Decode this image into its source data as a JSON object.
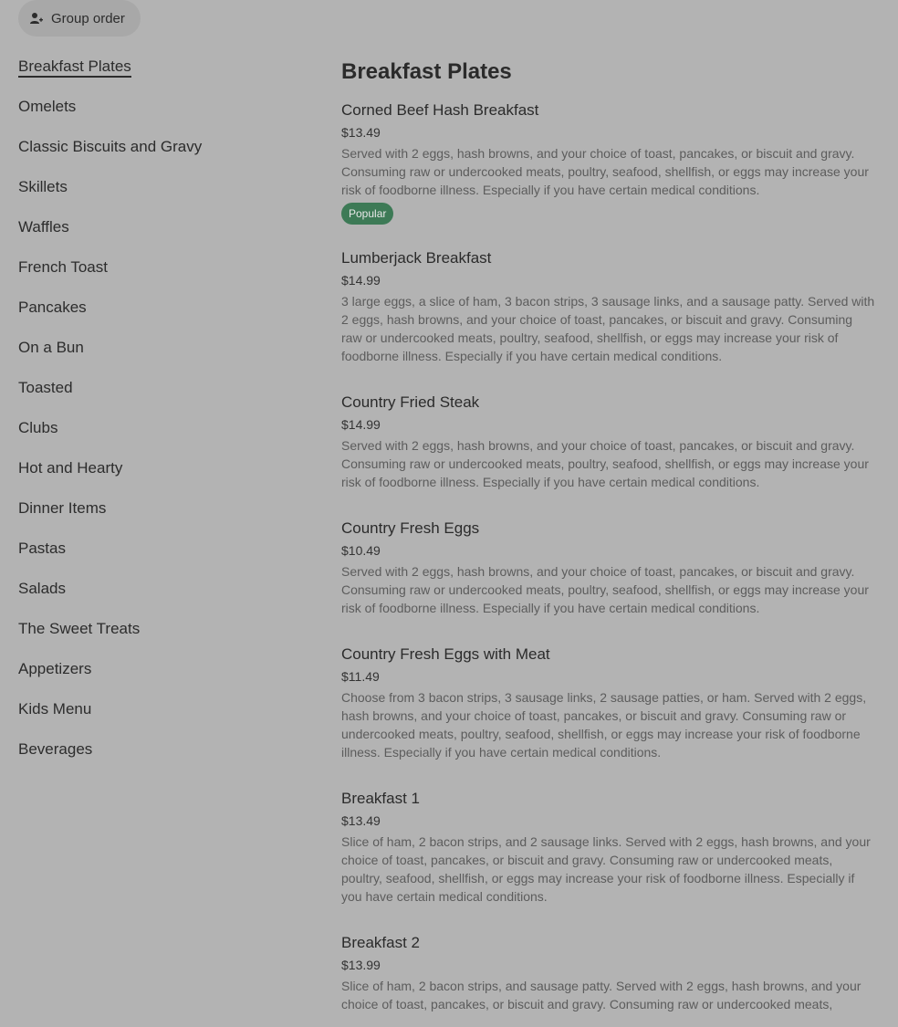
{
  "header": {
    "group_order_label": "Group order",
    "group_order_icon": "person-add-icon"
  },
  "sidebar": {
    "items": [
      {
        "label": "Breakfast Plates",
        "active": true
      },
      {
        "label": "Omelets"
      },
      {
        "label": "Classic Biscuits and Gravy"
      },
      {
        "label": "Skillets"
      },
      {
        "label": "Waffles"
      },
      {
        "label": "French Toast"
      },
      {
        "label": "Pancakes"
      },
      {
        "label": "On a Bun"
      },
      {
        "label": "Toasted"
      },
      {
        "label": "Clubs"
      },
      {
        "label": "Hot and Hearty"
      },
      {
        "label": "Dinner Items"
      },
      {
        "label": "Pastas"
      },
      {
        "label": "Salads"
      },
      {
        "label": "The Sweet Treats"
      },
      {
        "label": "Appetizers"
      },
      {
        "label": "Kids Menu"
      },
      {
        "label": "Beverages"
      }
    ]
  },
  "main": {
    "section_title": "Breakfast Plates",
    "items": [
      {
        "name": "Corned Beef Hash Breakfast",
        "price": "$13.49",
        "description": "Served with 2 eggs, hash browns, and your choice of toast, pancakes, or biscuit and gravy. Consuming raw or undercooked meats, poultry, seafood, shellfish, or eggs may increase your risk of foodborne illness. Especially if you have certain medical conditions.",
        "badge": "Popular"
      },
      {
        "name": "Lumberjack Breakfast",
        "price": "$14.99",
        "description": "3 large eggs, a slice of ham, 3 bacon strips, 3 sausage links, and a sausage patty. Served with 2 eggs, hash browns, and your choice of toast, pancakes, or biscuit and gravy. Consuming raw or undercooked meats, poultry, seafood, shellfish, or eggs may increase your risk of foodborne illness. Especially if you have certain medical conditions."
      },
      {
        "name": "Country Fried Steak",
        "price": "$14.99",
        "description": "Served with 2 eggs, hash browns, and your choice of toast, pancakes, or biscuit and gravy. Consuming raw or undercooked meats, poultry, seafood, shellfish, or eggs may increase your risk of foodborne illness. Especially if you have certain medical conditions."
      },
      {
        "name": "Country Fresh Eggs",
        "price": "$10.49",
        "description": "Served with 2 eggs, hash browns, and your choice of toast, pancakes, or biscuit and gravy. Consuming raw or undercooked meats, poultry, seafood, shellfish, or eggs may increase your risk of foodborne illness. Especially if you have certain medical conditions."
      },
      {
        "name": "Country Fresh Eggs with Meat",
        "price": "$11.49",
        "description": "Choose from 3 bacon strips, 3 sausage links, 2 sausage patties, or ham. Served with 2 eggs, hash browns, and your choice of toast, pancakes, or biscuit and gravy. Consuming raw or undercooked meats, poultry, seafood, shellfish, or eggs may increase your risk of foodborne illness. Especially if you have certain medical conditions."
      },
      {
        "name": "Breakfast 1",
        "price": "$13.49",
        "description": "Slice of ham, 2 bacon strips, and 2 sausage links. Served with 2 eggs, hash browns, and your choice of toast, pancakes, or biscuit and gravy. Consuming raw or undercooked meats, poultry, seafood, shellfish, or eggs may increase your risk of foodborne illness. Especially if you have certain medical conditions."
      },
      {
        "name": "Breakfast 2",
        "price": "$13.99",
        "description": "Slice of ham, 2 bacon strips, and sausage patty. Served with 2 eggs, hash browns, and your choice of toast, pancakes, or biscuit and gravy. Consuming raw or undercooked meats,"
      }
    ]
  },
  "colors": {
    "background": "#b3b3b3",
    "badge_green": "#3d7a56",
    "text": "#2e2e2e",
    "muted_text": "#5c5c5c"
  }
}
